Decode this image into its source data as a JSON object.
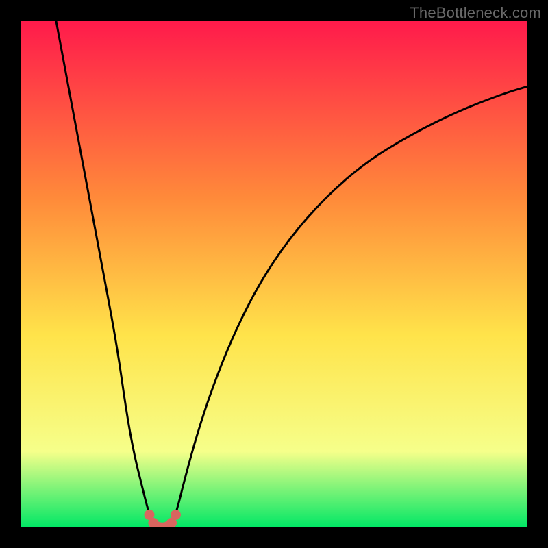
{
  "watermark": "TheBottleneck.com",
  "colors": {
    "background": "#000000",
    "gradient_top": "#ff1a4b",
    "gradient_mid_upper": "#ff8a3a",
    "gradient_mid": "#ffe34a",
    "gradient_lower": "#f6ff8a",
    "gradient_bottom": "#00e765",
    "curve": "#000000",
    "marker_fill": "#d9655f"
  },
  "chart_data": {
    "type": "line",
    "title": "",
    "xlabel": "",
    "ylabel": "",
    "xlim": [
      0,
      100
    ],
    "ylim": [
      0,
      100
    ],
    "annotations": [],
    "series": [
      {
        "name": "left-branch",
        "x": [
          7,
          10,
          13,
          16,
          19,
          21,
          22.5,
          24,
          25,
          25.8,
          26.3,
          26.8
        ],
        "y": [
          100,
          84,
          68,
          52,
          36,
          22,
          14,
          8,
          4,
          1.5,
          0.5,
          0
        ]
      },
      {
        "name": "right-branch",
        "x": [
          29.2,
          29.7,
          30.2,
          31,
          32.5,
          35,
          38,
          42,
          47,
          53,
          60,
          68,
          77,
          86,
          95,
          100
        ],
        "y": [
          0,
          0.5,
          1.5,
          4,
          10,
          19,
          28,
          38,
          48,
          57,
          65,
          72,
          77.5,
          82,
          85.5,
          87
        ]
      },
      {
        "name": "valley-floor",
        "x": [
          26.8,
          27.3,
          28,
          28.7,
          29.2
        ],
        "y": [
          0,
          0,
          0,
          0,
          0
        ]
      }
    ],
    "markers": {
      "name": "valley-markers",
      "x": [
        25.4,
        26.2,
        26.9,
        27.6,
        28.3,
        29.0,
        29.8,
        30.6
      ],
      "y": [
        2.5,
        0.9,
        0.2,
        0.0,
        0.0,
        0.2,
        0.9,
        2.5
      ]
    }
  }
}
